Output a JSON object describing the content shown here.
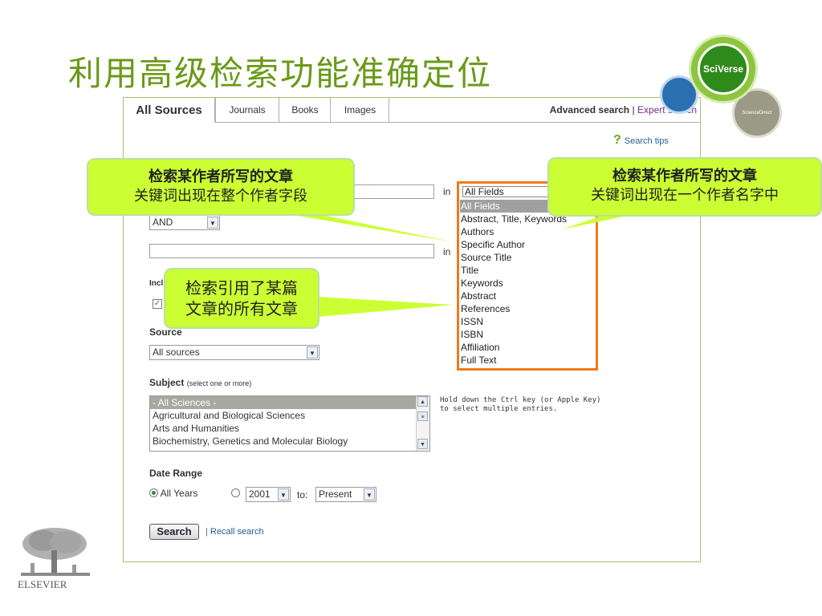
{
  "slide": {
    "title": "利用高级检索功能准确定位"
  },
  "logos": {
    "sciverse": "SciVerse",
    "sciencedirect": "ScienceDirect",
    "elsevier": "ELSEVIER"
  },
  "tabs": [
    {
      "label": "All Sources"
    },
    {
      "label": "Journals"
    },
    {
      "label": "Books"
    },
    {
      "label": "Images"
    }
  ],
  "header": {
    "advanced": "Advanced search",
    "separator": "|",
    "expert": "Expert search"
  },
  "search_tips": {
    "icon": "help-icon",
    "label": "Search tips"
  },
  "form": {
    "term1_in": "in",
    "field1_selected": "All Fields",
    "operator": "AND",
    "term2_in": "in",
    "include_label": "Incl",
    "source_label": "Source",
    "source_selected": "All sources",
    "subject_label": "Subject",
    "subject_hint_small": "(select one or more)",
    "subjects": [
      "- All Sciences -",
      "Agricultural and Biological Sciences",
      "Arts and Humanities",
      "Biochemistry, Genetics and Molecular Biology"
    ],
    "multi_hint_1": "Hold down the Ctrl key (or Apple Key)",
    "multi_hint_2": "to select multiple entries.",
    "date_label": "Date Range",
    "all_years": "All Years",
    "year_from": "2001",
    "to_label": "to:",
    "year_to": "Present",
    "search_button": "Search",
    "separator": "|",
    "recall": "Recall search"
  },
  "field_list": {
    "current": "All Fields",
    "options": [
      "All Fields",
      "Abstract, Title, Keywords",
      "Authors",
      "Specific Author",
      "Source Title",
      "Title",
      "Keywords",
      "Abstract",
      "References",
      "ISSN",
      "ISBN",
      "Affiliation",
      "Full Text"
    ]
  },
  "callouts": {
    "left": {
      "line1": "检索某作者所写的文章",
      "line2": "关键词出现在整个作者字段"
    },
    "right": {
      "line1": "检索某作者所写的文章",
      "line2": "关键词出现在一个作者名字中"
    },
    "middle": {
      "line1": "检索引用了某篇",
      "line2": "文章的所有文章"
    }
  }
}
